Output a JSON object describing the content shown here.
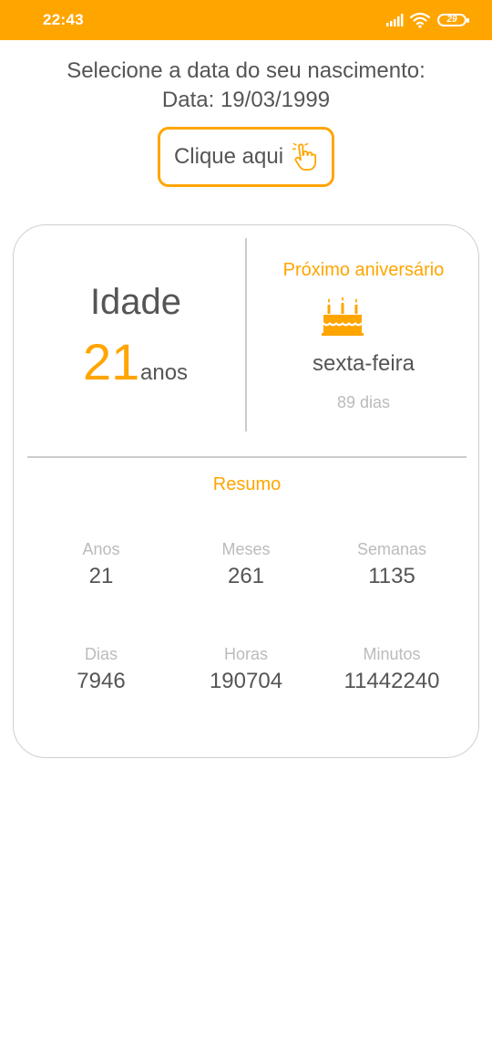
{
  "status_bar": {
    "time": "22:43",
    "battery": "29",
    "icons": [
      "signal-icon",
      "wifi-icon",
      "battery-icon"
    ],
    "color": "#ffa500"
  },
  "prompt": "Selecione a data do seu nascimento:",
  "date_line": "Data: 19/03/1999",
  "button": {
    "label": "Clique aqui",
    "icon": "pointing-hand-icon"
  },
  "age": {
    "title": "Idade",
    "value": "21",
    "unit": "anos"
  },
  "next_birthday": {
    "title": "Próximo aniversário",
    "icon": "birthday-cake-icon",
    "weekday": "sexta-feira",
    "days": "89 dias"
  },
  "summary": {
    "title": "Resumo",
    "stats": [
      {
        "label": "Anos",
        "value": "21"
      },
      {
        "label": "Meses",
        "value": "261"
      },
      {
        "label": "Semanas",
        "value": "1135"
      },
      {
        "label": "Dias",
        "value": "7946"
      },
      {
        "label": "Horas",
        "value": "190704"
      },
      {
        "label": "Minutos",
        "value": "11442240"
      }
    ]
  },
  "colors": {
    "accent": "#ffa500",
    "text": "#555555",
    "muted": "#bbbbbb",
    "border": "#cfcfcf"
  }
}
